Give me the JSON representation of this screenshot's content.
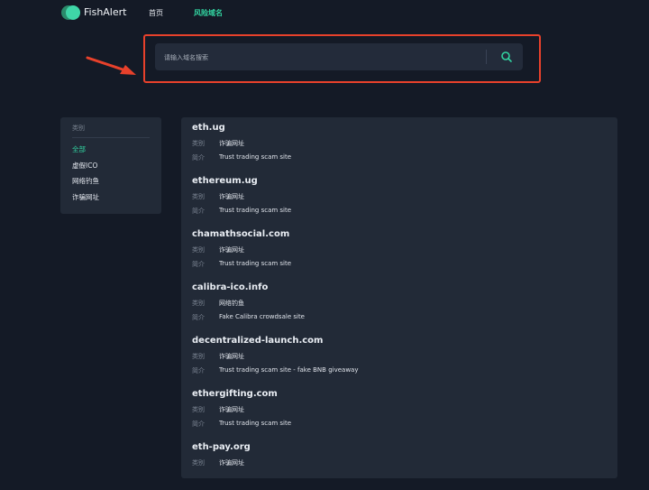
{
  "header": {
    "brand": "FishAlert",
    "nav": [
      {
        "label": "首页"
      },
      {
        "label": "风险域名"
      }
    ]
  },
  "search": {
    "placeholder": "请输入域名搜索",
    "value": ""
  },
  "sidebar": {
    "title": "类别",
    "items": [
      {
        "label": "全部",
        "active": true
      },
      {
        "label": "虚假ICO"
      },
      {
        "label": "网络钓鱼"
      },
      {
        "label": "诈骗网址"
      }
    ]
  },
  "list": {
    "category_label": "类别",
    "intro_label": "简介",
    "entries": [
      {
        "domain": "eth.ug",
        "category": "诈骗网址",
        "intro": "Trust trading scam site"
      },
      {
        "domain": "ethereum.ug",
        "category": "诈骗网址",
        "intro": "Trust trading scam site"
      },
      {
        "domain": "chamathsocial.com",
        "category": "诈骗网址",
        "intro": "Trust trading scam site"
      },
      {
        "domain": "calibra-ico.info",
        "category": "网络钓鱼",
        "intro": "Fake Calibra crowdsale site"
      },
      {
        "domain": "decentralized-launch.com",
        "category": "诈骗网址",
        "intro": "Trust trading scam site - fake BNB giveaway"
      },
      {
        "domain": "ethergifting.com",
        "category": "诈骗网址",
        "intro": "Trust trading scam site"
      },
      {
        "domain": "eth-pay.org",
        "category": "诈骗网址",
        "intro": ""
      }
    ]
  },
  "colors": {
    "background": "#141a26",
    "panel": "#222a37",
    "accent": "#32d3a0",
    "highlight_border": "#e8412b"
  },
  "icons": [
    "logo-icon",
    "search-icon",
    "arrow-annotation-icon"
  ]
}
